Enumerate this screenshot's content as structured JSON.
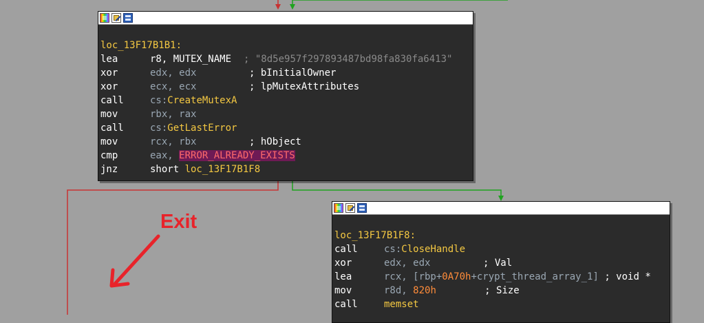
{
  "colors": {
    "background": "#a0a0a0",
    "node_bg": "#2b2b2b",
    "edge_true": "#1fa31f",
    "edge_false": "#c83232",
    "annotation": "#e8232a"
  },
  "node1": {
    "title_icons": [
      "color-palette-icon",
      "rename-icon",
      "graph-overview-icon"
    ],
    "label": "loc_13F17B1B1:",
    "lines": [
      {
        "mn": "lea",
        "ops": "r8, MUTEX_NAME",
        "cmt": "; \"8d5e957f297893487bd98fa830fa6413\""
      },
      {
        "mn": "xor",
        "ops": "edx, edx",
        "cmt": "; bInitialOwner"
      },
      {
        "mn": "xor",
        "ops": "ecx, ecx",
        "cmt": "; lpMutexAttributes"
      },
      {
        "mn": "call",
        "ops_prefix": "cs:",
        "ops_name": "CreateMutexA"
      },
      {
        "mn": "mov",
        "ops": "rbx, rax"
      },
      {
        "mn": "call",
        "ops_prefix": "cs:",
        "ops_name": "GetLastError"
      },
      {
        "mn": "mov",
        "ops": "rcx, rbx",
        "cmt": "; hObject"
      },
      {
        "mn": "cmp",
        "ops": "eax, ",
        "const": "ERROR_ALREADY_EXISTS"
      },
      {
        "mn": "jnz",
        "ops": "short ",
        "target": "loc_13F17B1F8"
      }
    ]
  },
  "node2": {
    "title_icons": [
      "color-palette-icon",
      "rename-icon",
      "graph-overview-icon"
    ],
    "label": "loc_13F17B1F8:",
    "lines": [
      {
        "mn": "call",
        "ops_prefix": "cs:",
        "ops_name": "CloseHandle"
      },
      {
        "mn": "xor",
        "ops": "edx, edx",
        "cmt": "; Val"
      },
      {
        "mn": "lea",
        "ops_a": "rcx, [rbp+",
        "num": "0A70h",
        "ops_b": "+crypt_thread_array_1]",
        "cmt": "; void *"
      },
      {
        "mn": "mov",
        "ops_a": "r8d, ",
        "num": "820h",
        "cmt": "; Size"
      },
      {
        "mn": "call",
        "target": "memset"
      }
    ]
  },
  "annotation": {
    "text": "Exit"
  }
}
